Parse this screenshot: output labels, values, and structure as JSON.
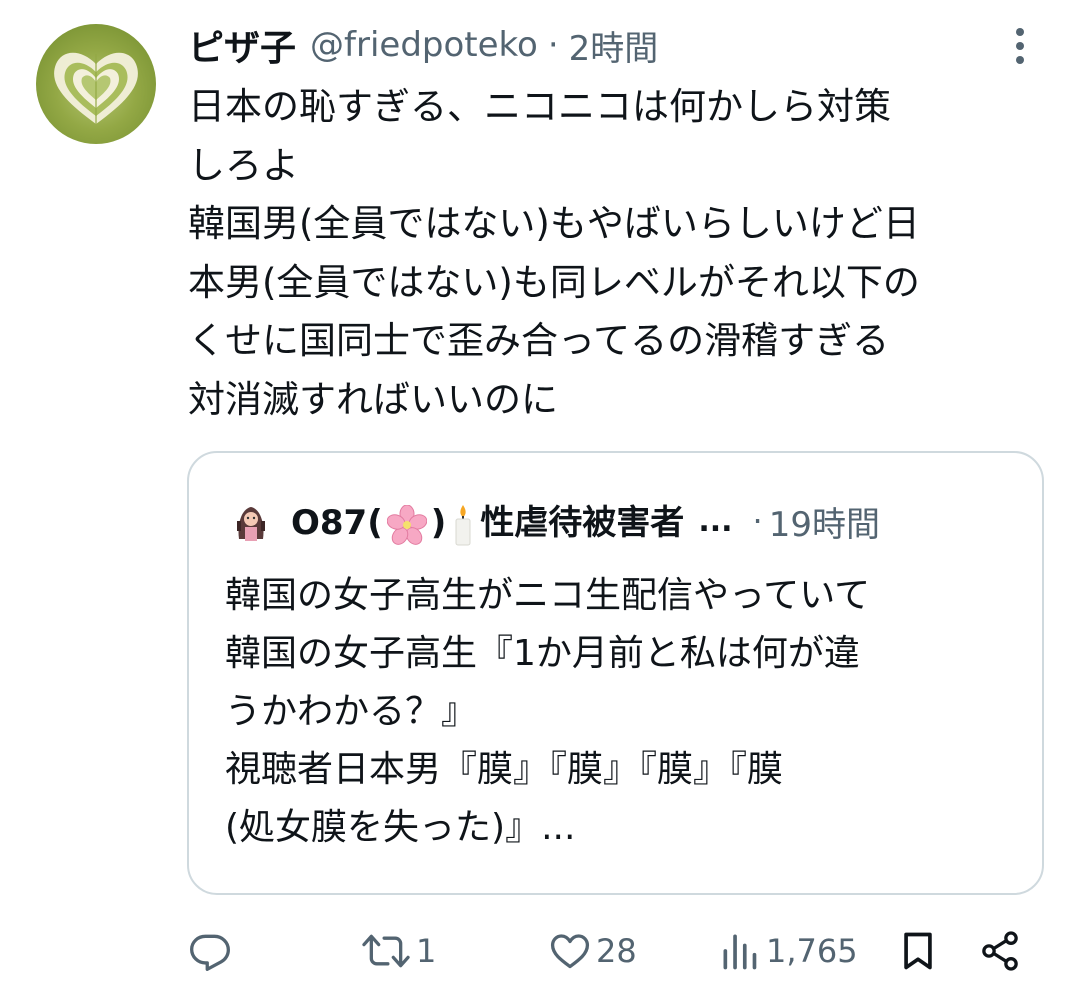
{
  "tweet": {
    "display_name": "ピザ子",
    "handle": "@friedpoteko",
    "separator": "·",
    "time": "2時間",
    "text_lines": [
      "日本の恥すぎる、ニコニコは何かしら対策",
      "しろよ",
      "韓国男(全員ではない)もやばいらしいけど日",
      "本男(全員ではない)も同レベルがそれ以下の",
      "くせに国同士で歪み合ってるの滑稽すぎる",
      "対消滅すればいいのに"
    ]
  },
  "quote": {
    "name_prefix": "O87(",
    "name_suffix": ")",
    "name_rest": "性虐待被害者",
    "ellipsis": "...",
    "separator": "·",
    "time": "19時間",
    "text_lines": [
      "韓国の女子高生がニコ生配信やっていて",
      "韓国の女子高生『1か月前と私は何が違",
      "うかわかる？』",
      "視聴者日本男『膜』『膜』『膜』『膜",
      "(処女膜を失った)』..."
    ]
  },
  "actions": {
    "reply_icon": "reply-icon",
    "retweet_count": "1",
    "like_count": "28",
    "views_count": "1,765",
    "bookmark_icon": "bookmark-icon",
    "share_icon": "share-icon"
  },
  "colors": {
    "text": "#0f1419",
    "secondary": "#536471",
    "border": "#cfd9de",
    "avatar_green": "#93a845"
  }
}
